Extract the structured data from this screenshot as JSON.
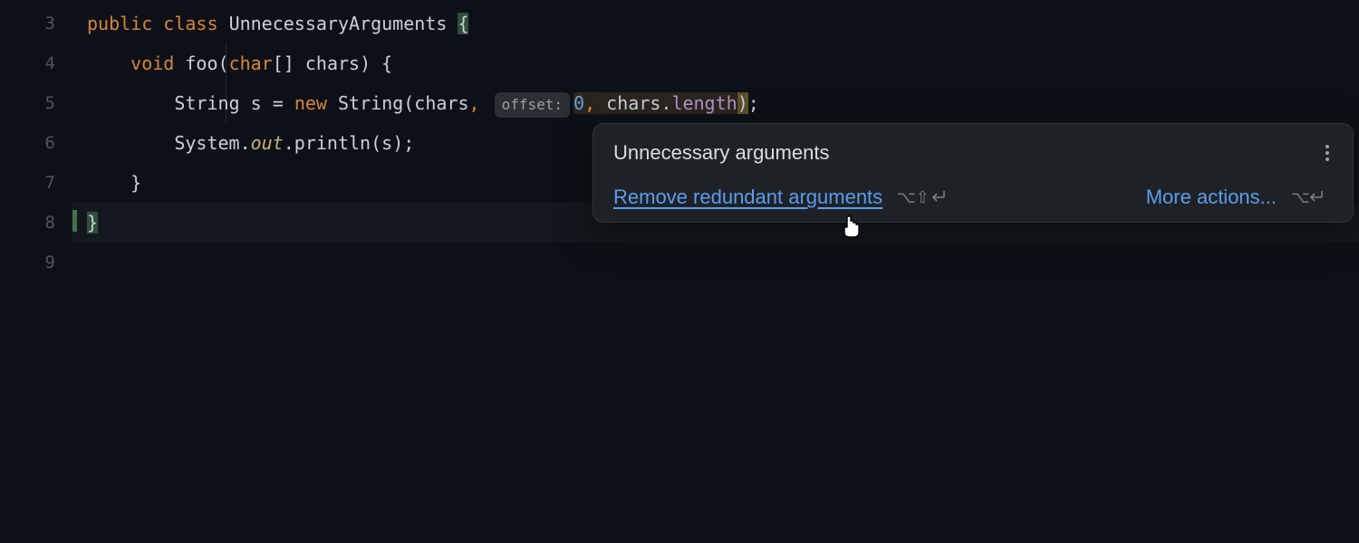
{
  "gutter": {
    "lines": [
      "3",
      "4",
      "5",
      "6",
      "7",
      "8",
      "9"
    ]
  },
  "code": {
    "l3": {
      "kw1": "public",
      "kw2": "class",
      "name": "UnnecessaryArguments",
      "brace": "{"
    },
    "l4": {
      "kw1": "void",
      "fn": "foo",
      "p1": "(",
      "kw2": "char",
      "arr": "[] ",
      "param": "chars",
      "p2": ") {"
    },
    "l5": {
      "type": "String ",
      "var": "s ",
      "eq": "= ",
      "kw": "new ",
      "ctor": "String",
      "p1": "(",
      "a1": "chars",
      "c1": ", ",
      "hint": "offset:",
      "a2": "0",
      "c2": ", ",
      "a3": "chars",
      "dot": ".",
      "a4": "length",
      "p2": ")",
      "semi": ";"
    },
    "l6": {
      "sys": "System",
      "d1": ".",
      "out": "out",
      "d2": ".",
      "fn": "println",
      "p1": "(",
      "arg": "s",
      "p2": ")",
      "semi": ";"
    },
    "l7": {
      "brace": "}"
    },
    "l8": {
      "brace": "}"
    }
  },
  "popup": {
    "title": "Unnecessary arguments",
    "fix": "Remove redundant arguments",
    "fix_shortcut": "⌥⇧↵",
    "more": "More actions...",
    "more_shortcut": "⌥↵"
  }
}
